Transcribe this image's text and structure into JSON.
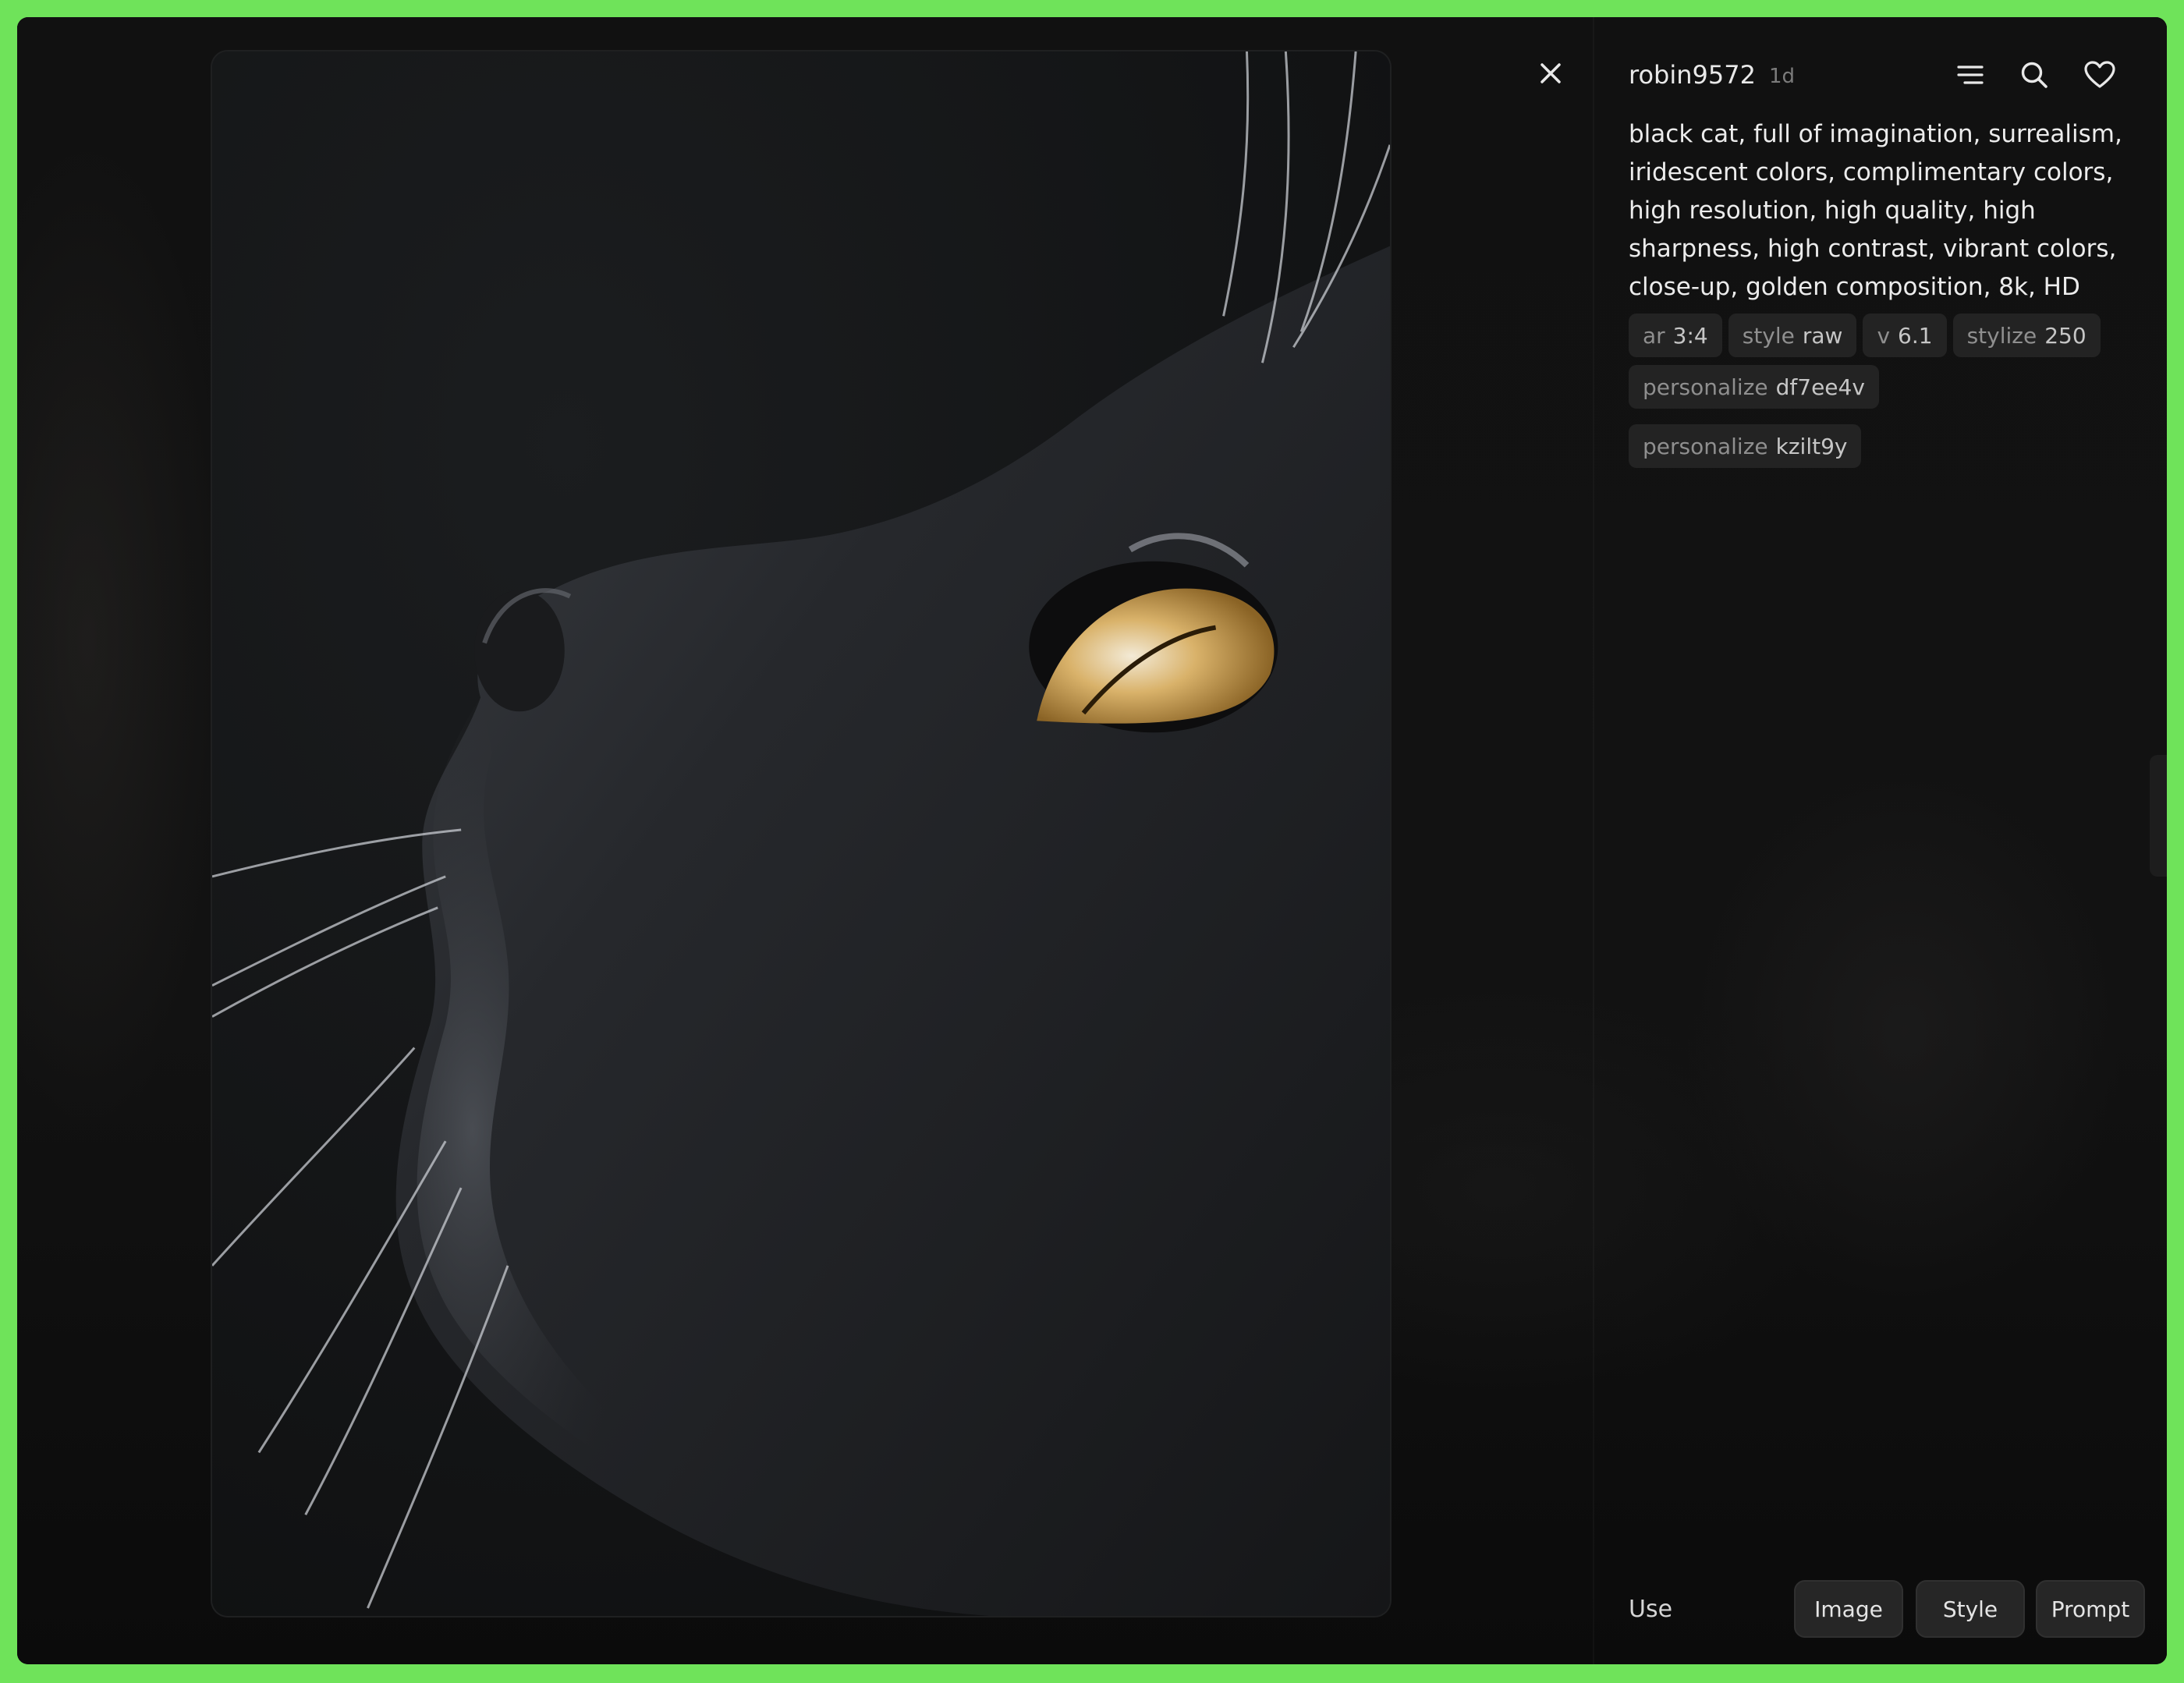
{
  "header": {
    "username": "robin9572",
    "time_ago": "1d"
  },
  "icons": {
    "close": "close-icon",
    "menu": "menu-icon",
    "search": "search-icon",
    "like": "heart-icon"
  },
  "prompt": {
    "text": "black cat, full of imagination, surrealism, iridescent colors, complimentary colors, high resolution, high quality, high sharpness, high contrast, vibrant colors, close-up, golden composition, 8k, HD"
  },
  "parameters": [
    {
      "key": "ar",
      "value": "3:4"
    },
    {
      "key": "style",
      "value": "raw"
    },
    {
      "key": "v",
      "value": "6.1"
    },
    {
      "key": "stylize",
      "value": "250"
    },
    {
      "key": "personalize",
      "value": "df7ee4v"
    },
    {
      "key": "personalize",
      "value": "kzilt9y"
    }
  ],
  "footer": {
    "use_label": "Use",
    "image_button": "Image",
    "style_button": "Style",
    "prompt_button": "Prompt"
  },
  "colors": {
    "outer_frame": "#6fe35a",
    "panel_bg": "#0f0f0f",
    "tag_bg": "#232323",
    "eye_gold": "#c99a3e"
  }
}
